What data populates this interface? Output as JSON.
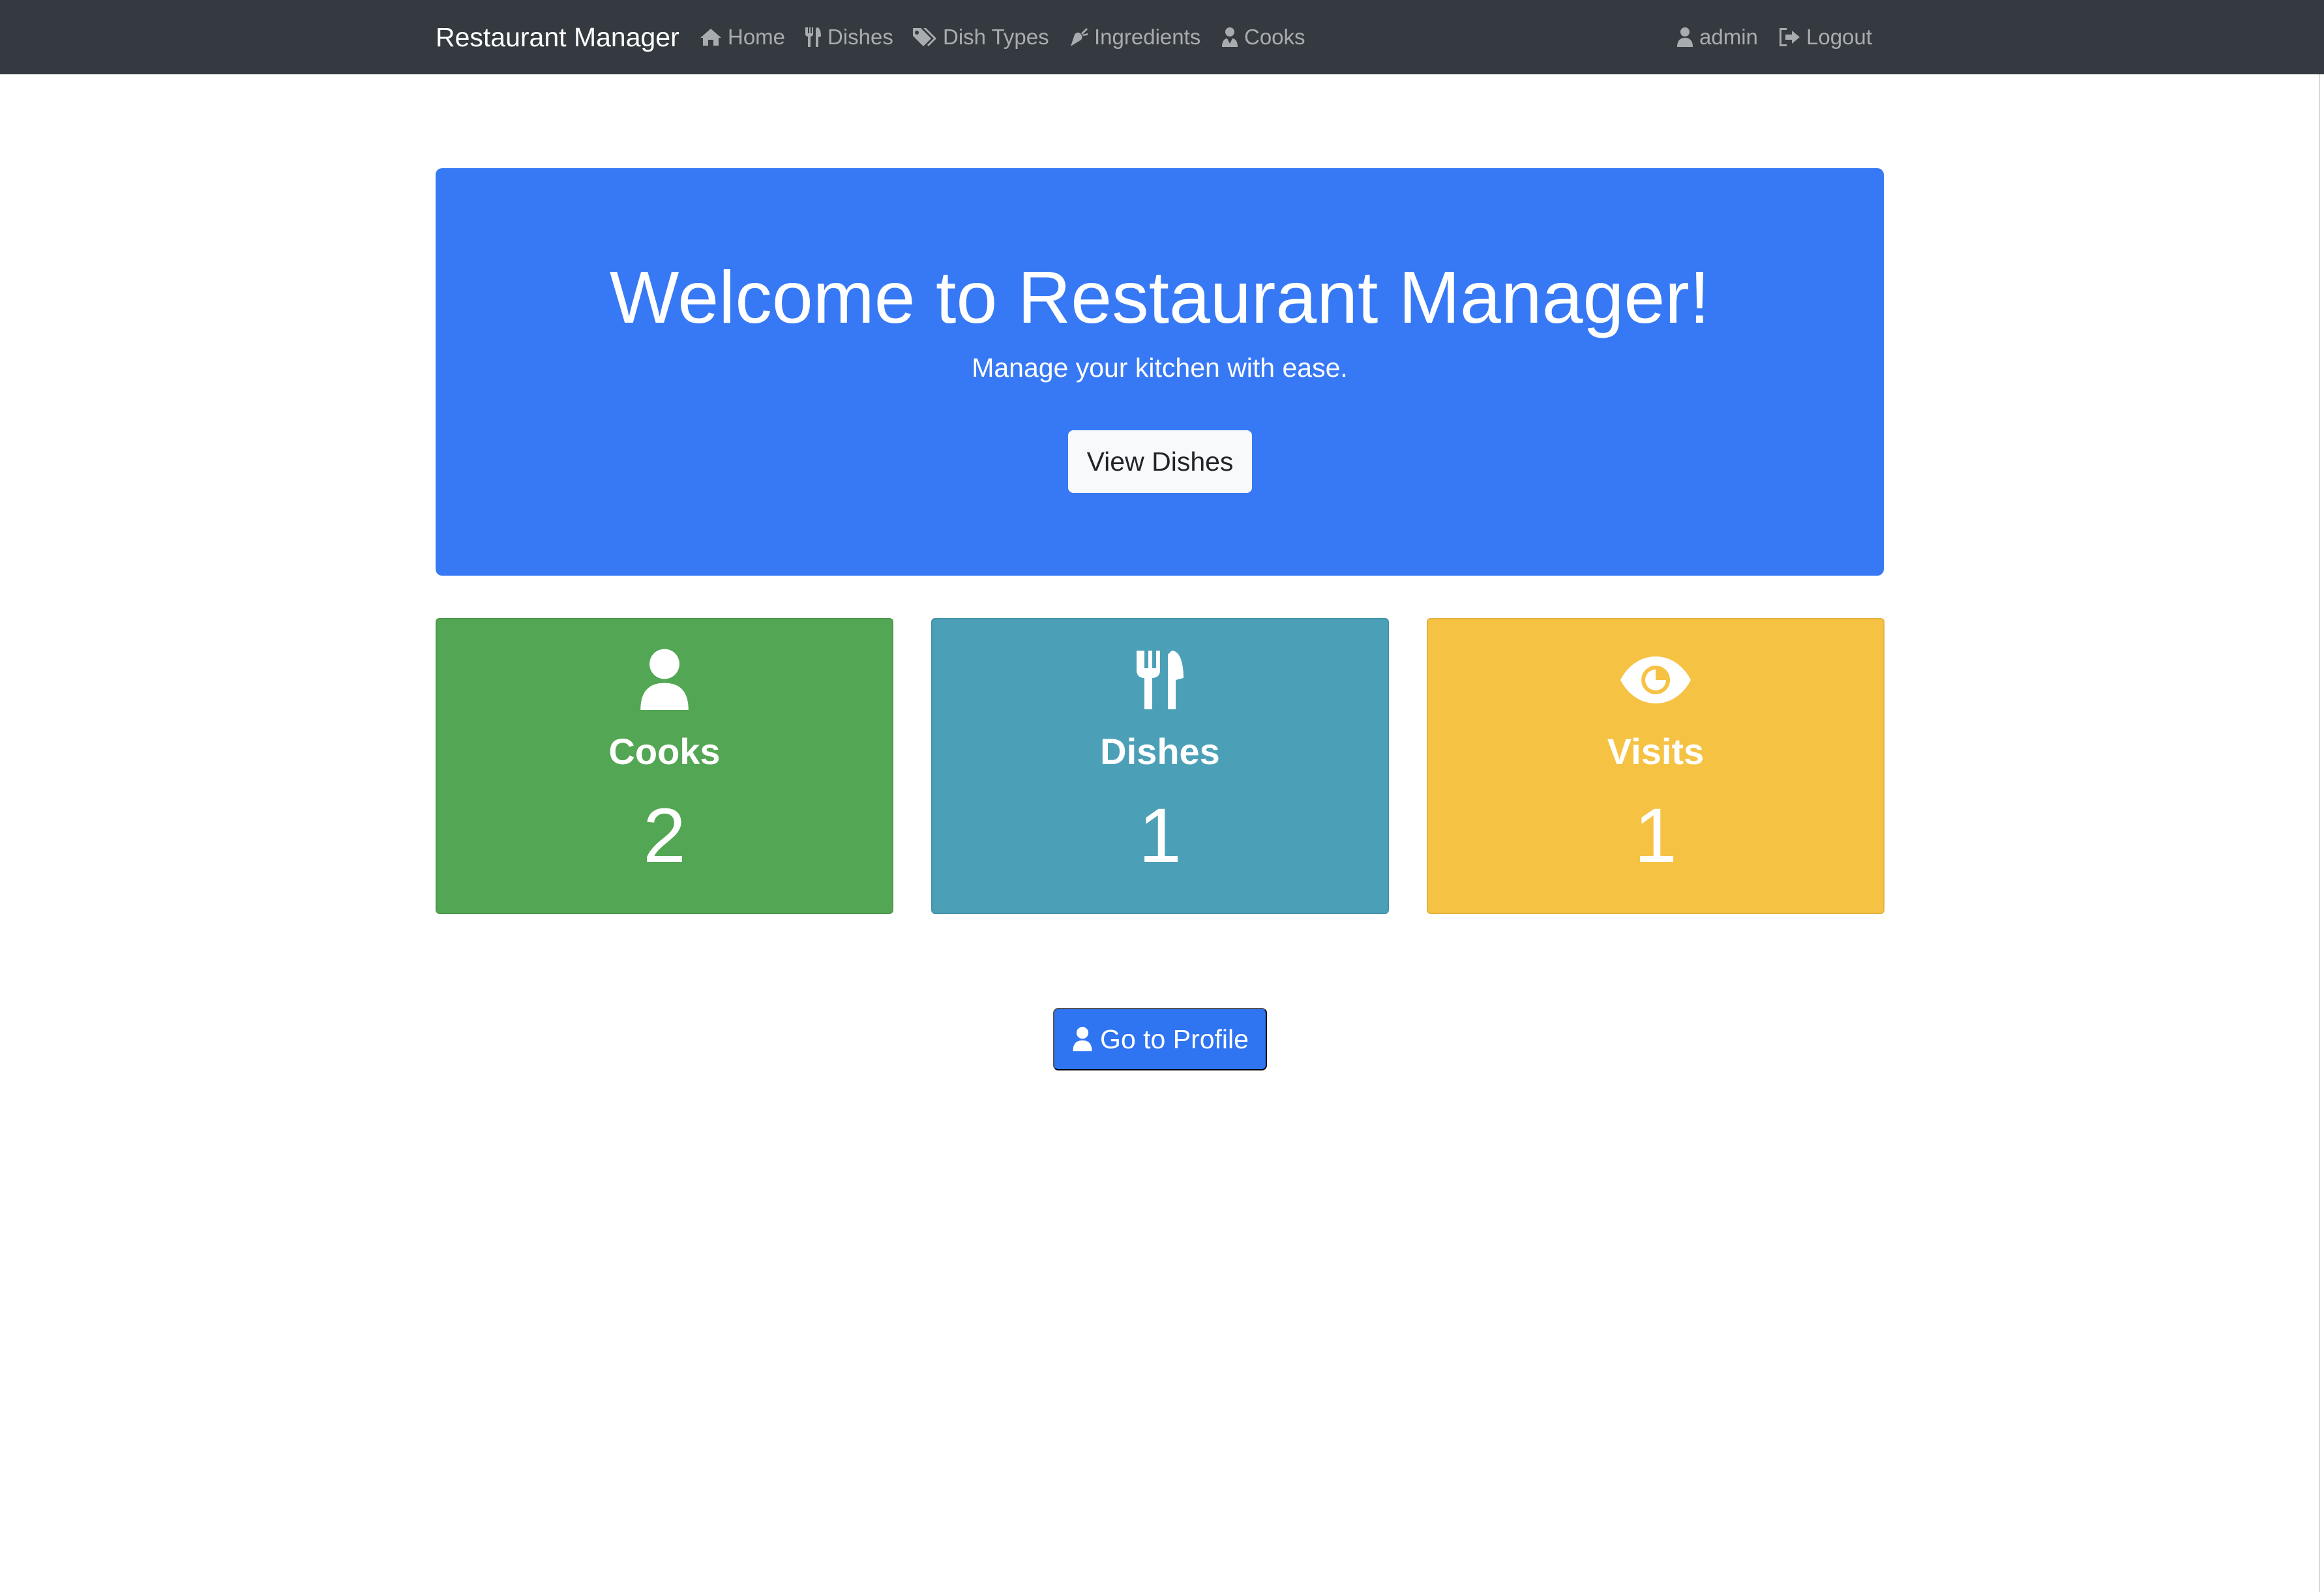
{
  "navbar": {
    "brand": "Restaurant Manager",
    "items": [
      {
        "label": "Home",
        "icon": "home-icon"
      },
      {
        "label": "Dishes",
        "icon": "utensils-icon"
      },
      {
        "label": "Dish Types",
        "icon": "tags-icon"
      },
      {
        "label": "Ingredients",
        "icon": "carrot-icon"
      },
      {
        "label": "Cooks",
        "icon": "user-tie-icon"
      }
    ],
    "user": {
      "label": "admin",
      "icon": "user-icon"
    },
    "logout": {
      "label": "Logout",
      "icon": "sign-out-icon"
    }
  },
  "hero": {
    "title": "Welcome to Restaurant Manager!",
    "subtitle": "Manage your kitchen with ease.",
    "button_label": "View Dishes",
    "background_color": "#3779f5"
  },
  "stats": [
    {
      "label": "Cooks",
      "value": "2",
      "icon": "user-icon",
      "color": "#53a653"
    },
    {
      "label": "Dishes",
      "value": "1",
      "icon": "utensils-icon",
      "color": "#4ba0b7"
    },
    {
      "label": "Visits",
      "value": "1",
      "icon": "eye-icon",
      "color": "#f6c244"
    }
  ],
  "profile_button": {
    "label": "Go to Profile",
    "icon": "user-icon"
  }
}
